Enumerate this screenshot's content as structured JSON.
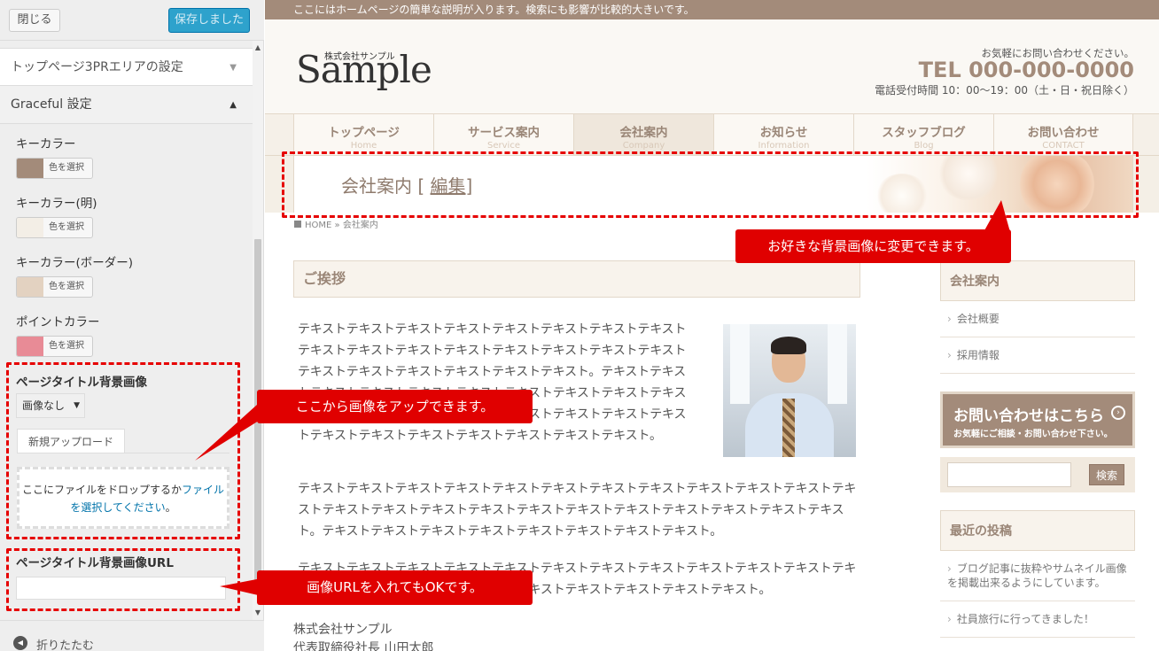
{
  "customizer": {
    "close_label": "閉じる",
    "save_label": "保存しました",
    "sections": [
      {
        "label": "トップページ3PRエリアの設定",
        "arrow": "▼"
      },
      {
        "label": "Graceful 設定",
        "arrow": "▲"
      }
    ],
    "colors": [
      {
        "label": "キーカラー",
        "color": "#a38b7a",
        "button": "色を選択"
      },
      {
        "label": "キーカラー(明)",
        "color": "#f3eee6",
        "button": "色を選択"
      },
      {
        "label": "キーカラー(ボーダー)",
        "color": "#e3d2c1",
        "button": "色を選択"
      },
      {
        "label": "ポイントカラー",
        "color": "#e88b96",
        "button": "色を選択"
      }
    ],
    "bg_image": {
      "label": "ページタイトル背景画像",
      "select_value": "画像なし",
      "tab_label": "新規アップロード",
      "drop_text_1": "ここにファイルをドロップするか",
      "drop_link": "ファイルを選択してください",
      "drop_text_2": "。"
    },
    "bg_url": {
      "label": "ページタイトル背景画像URL",
      "value": ""
    },
    "collapse_label": "折りたたむ"
  },
  "site": {
    "tagline": "ここにはホームページの簡単な説明が入ります。検索にも影響が比較的大きいです。",
    "logo_sub": "株式会社サンプル",
    "logo": "Sample",
    "contact_note": "お気軽にお問い合わせください。",
    "tel": "TEL 000-000-0000",
    "hours": "電話受付時間 10：00〜19：00（土・日・祝日除く）",
    "nav": [
      {
        "ja": "トップページ",
        "en": "Home"
      },
      {
        "ja": "サービス案内",
        "en": "Service"
      },
      {
        "ja": "会社案内",
        "en": "Company"
      },
      {
        "ja": "お知らせ",
        "en": "Information"
      },
      {
        "ja": "スタッフブログ",
        "en": "Blog"
      },
      {
        "ja": "お問い合わせ",
        "en": "CONTACT"
      }
    ],
    "page_title": "会社案内 [ ",
    "edit_link": "編集",
    "page_title_end": "]",
    "breadcrumb_home": "HOME",
    "breadcrumb_sep": "»",
    "breadcrumb_current": "会社案内",
    "heading": "ご挨拶",
    "para1": "テキストテキストテキストテキストテキストテキストテキストテキストテキストテキストテキストテキストテキストテキストテキストテキストテキストテキストテキストテキストテキストテキスト。テキストテキストテキストテキストテキストテキストテキストテキストテキストテキストテキストテキストテキストテキストテキストテキストテキストテキストテキストテキストテキストテキストテキストテキストテキスト。",
    "para2": "テキストテキストテキストテキストテキストテキストテキストテキストテキストテキストテキストテキストテキストテキストテキストテキストテキストテキストテキストテキストテキストテキストテキスト。テキストテキストテキストテキストテキストテキストテキストテキスト。",
    "para3": "テキストテキストテキストテキストテキストテキストテキストテキストテキストテキストテキストテキストテキストテキストテキストテキストテキストテキストテキストテキストテキスト。",
    "company_name": "株式会社サンプル",
    "ceo": "代表取締役社長 山田太郎",
    "sidebar": {
      "company_heading": "会社案内",
      "company_links": [
        "会社概要",
        "採用情報"
      ],
      "banner_main": "お問い合わせはこちら",
      "banner_sub": "お気軽にご相談・お問い合わせ下さい。",
      "search_button": "検索",
      "recent_heading": "最近の投稿",
      "recent_posts": [
        "ブログ記事に抜粋やサムネイル画像を掲載出来るようにしています。",
        "社員旅行に行ってきました！"
      ]
    }
  },
  "annotations": {
    "bg_change": "お好きな背景画像に変更できます。",
    "upload": "ここから画像をアップできます。",
    "url_ok": "画像URLを入れてもOKです。"
  }
}
